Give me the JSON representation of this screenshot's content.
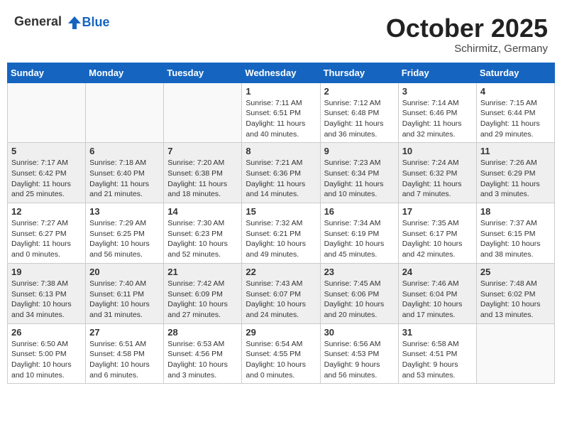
{
  "header": {
    "logo_general": "General",
    "logo_blue": "Blue",
    "month": "October 2025",
    "location": "Schirmitz, Germany"
  },
  "weekdays": [
    "Sunday",
    "Monday",
    "Tuesday",
    "Wednesday",
    "Thursday",
    "Friday",
    "Saturday"
  ],
  "weeks": [
    [
      {
        "day": "",
        "sunrise": "",
        "sunset": "",
        "daylight": ""
      },
      {
        "day": "",
        "sunrise": "",
        "sunset": "",
        "daylight": ""
      },
      {
        "day": "",
        "sunrise": "",
        "sunset": "",
        "daylight": ""
      },
      {
        "day": "1",
        "sunrise": "Sunrise: 7:11 AM",
        "sunset": "Sunset: 6:51 PM",
        "daylight": "Daylight: 11 hours and 40 minutes."
      },
      {
        "day": "2",
        "sunrise": "Sunrise: 7:12 AM",
        "sunset": "Sunset: 6:48 PM",
        "daylight": "Daylight: 11 hours and 36 minutes."
      },
      {
        "day": "3",
        "sunrise": "Sunrise: 7:14 AM",
        "sunset": "Sunset: 6:46 PM",
        "daylight": "Daylight: 11 hours and 32 minutes."
      },
      {
        "day": "4",
        "sunrise": "Sunrise: 7:15 AM",
        "sunset": "Sunset: 6:44 PM",
        "daylight": "Daylight: 11 hours and 29 minutes."
      }
    ],
    [
      {
        "day": "5",
        "sunrise": "Sunrise: 7:17 AM",
        "sunset": "Sunset: 6:42 PM",
        "daylight": "Daylight: 11 hours and 25 minutes."
      },
      {
        "day": "6",
        "sunrise": "Sunrise: 7:18 AM",
        "sunset": "Sunset: 6:40 PM",
        "daylight": "Daylight: 11 hours and 21 minutes."
      },
      {
        "day": "7",
        "sunrise": "Sunrise: 7:20 AM",
        "sunset": "Sunset: 6:38 PM",
        "daylight": "Daylight: 11 hours and 18 minutes."
      },
      {
        "day": "8",
        "sunrise": "Sunrise: 7:21 AM",
        "sunset": "Sunset: 6:36 PM",
        "daylight": "Daylight: 11 hours and 14 minutes."
      },
      {
        "day": "9",
        "sunrise": "Sunrise: 7:23 AM",
        "sunset": "Sunset: 6:34 PM",
        "daylight": "Daylight: 11 hours and 10 minutes."
      },
      {
        "day": "10",
        "sunrise": "Sunrise: 7:24 AM",
        "sunset": "Sunset: 6:32 PM",
        "daylight": "Daylight: 11 hours and 7 minutes."
      },
      {
        "day": "11",
        "sunrise": "Sunrise: 7:26 AM",
        "sunset": "Sunset: 6:29 PM",
        "daylight": "Daylight: 11 hours and 3 minutes."
      }
    ],
    [
      {
        "day": "12",
        "sunrise": "Sunrise: 7:27 AM",
        "sunset": "Sunset: 6:27 PM",
        "daylight": "Daylight: 11 hours and 0 minutes."
      },
      {
        "day": "13",
        "sunrise": "Sunrise: 7:29 AM",
        "sunset": "Sunset: 6:25 PM",
        "daylight": "Daylight: 10 hours and 56 minutes."
      },
      {
        "day": "14",
        "sunrise": "Sunrise: 7:30 AM",
        "sunset": "Sunset: 6:23 PM",
        "daylight": "Daylight: 10 hours and 52 minutes."
      },
      {
        "day": "15",
        "sunrise": "Sunrise: 7:32 AM",
        "sunset": "Sunset: 6:21 PM",
        "daylight": "Daylight: 10 hours and 49 minutes."
      },
      {
        "day": "16",
        "sunrise": "Sunrise: 7:34 AM",
        "sunset": "Sunset: 6:19 PM",
        "daylight": "Daylight: 10 hours and 45 minutes."
      },
      {
        "day": "17",
        "sunrise": "Sunrise: 7:35 AM",
        "sunset": "Sunset: 6:17 PM",
        "daylight": "Daylight: 10 hours and 42 minutes."
      },
      {
        "day": "18",
        "sunrise": "Sunrise: 7:37 AM",
        "sunset": "Sunset: 6:15 PM",
        "daylight": "Daylight: 10 hours and 38 minutes."
      }
    ],
    [
      {
        "day": "19",
        "sunrise": "Sunrise: 7:38 AM",
        "sunset": "Sunset: 6:13 PM",
        "daylight": "Daylight: 10 hours and 34 minutes."
      },
      {
        "day": "20",
        "sunrise": "Sunrise: 7:40 AM",
        "sunset": "Sunset: 6:11 PM",
        "daylight": "Daylight: 10 hours and 31 minutes."
      },
      {
        "day": "21",
        "sunrise": "Sunrise: 7:42 AM",
        "sunset": "Sunset: 6:09 PM",
        "daylight": "Daylight: 10 hours and 27 minutes."
      },
      {
        "day": "22",
        "sunrise": "Sunrise: 7:43 AM",
        "sunset": "Sunset: 6:07 PM",
        "daylight": "Daylight: 10 hours and 24 minutes."
      },
      {
        "day": "23",
        "sunrise": "Sunrise: 7:45 AM",
        "sunset": "Sunset: 6:06 PM",
        "daylight": "Daylight: 10 hours and 20 minutes."
      },
      {
        "day": "24",
        "sunrise": "Sunrise: 7:46 AM",
        "sunset": "Sunset: 6:04 PM",
        "daylight": "Daylight: 10 hours and 17 minutes."
      },
      {
        "day": "25",
        "sunrise": "Sunrise: 7:48 AM",
        "sunset": "Sunset: 6:02 PM",
        "daylight": "Daylight: 10 hours and 13 minutes."
      }
    ],
    [
      {
        "day": "26",
        "sunrise": "Sunrise: 6:50 AM",
        "sunset": "Sunset: 5:00 PM",
        "daylight": "Daylight: 10 hours and 10 minutes."
      },
      {
        "day": "27",
        "sunrise": "Sunrise: 6:51 AM",
        "sunset": "Sunset: 4:58 PM",
        "daylight": "Daylight: 10 hours and 6 minutes."
      },
      {
        "day": "28",
        "sunrise": "Sunrise: 6:53 AM",
        "sunset": "Sunset: 4:56 PM",
        "daylight": "Daylight: 10 hours and 3 minutes."
      },
      {
        "day": "29",
        "sunrise": "Sunrise: 6:54 AM",
        "sunset": "Sunset: 4:55 PM",
        "daylight": "Daylight: 10 hours and 0 minutes."
      },
      {
        "day": "30",
        "sunrise": "Sunrise: 6:56 AM",
        "sunset": "Sunset: 4:53 PM",
        "daylight": "Daylight: 9 hours and 56 minutes."
      },
      {
        "day": "31",
        "sunrise": "Sunrise: 6:58 AM",
        "sunset": "Sunset: 4:51 PM",
        "daylight": "Daylight: 9 hours and 53 minutes."
      },
      {
        "day": "",
        "sunrise": "",
        "sunset": "",
        "daylight": ""
      }
    ]
  ]
}
